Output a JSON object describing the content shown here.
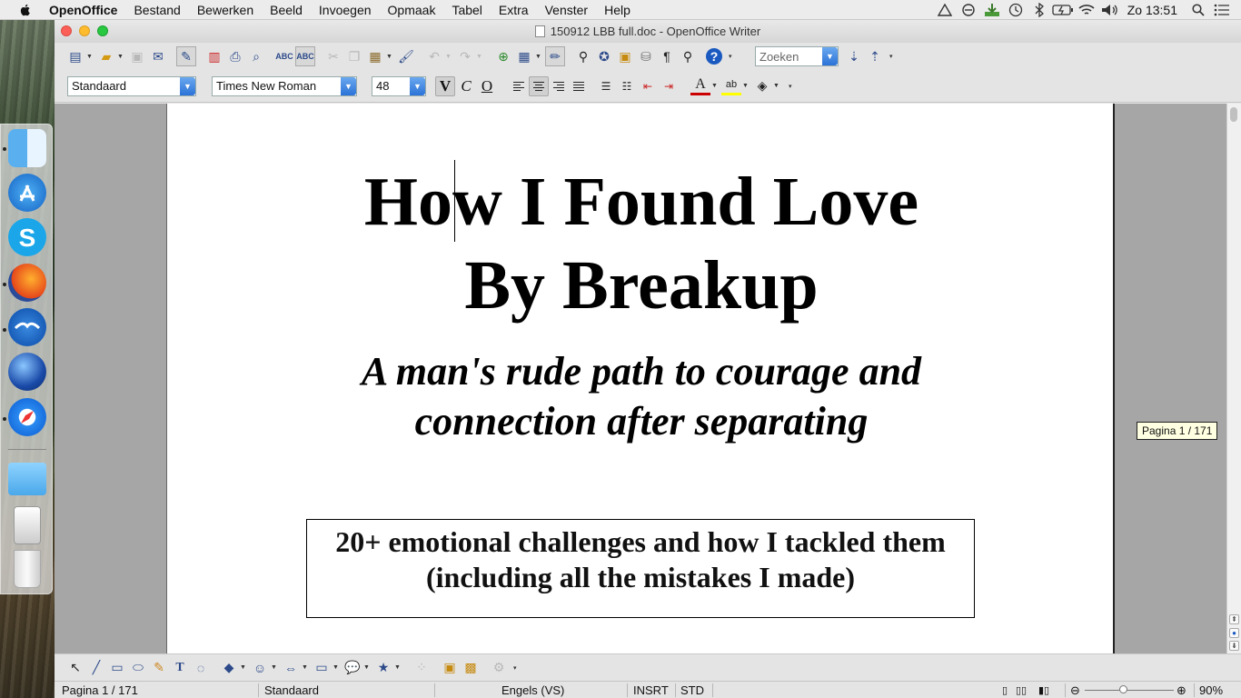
{
  "menubar": {
    "app_name": "OpenOffice",
    "items": [
      "Bestand",
      "Bewerken",
      "Beeld",
      "Invoegen",
      "Opmaak",
      "Tabel",
      "Extra",
      "Venster",
      "Help"
    ],
    "clock": "Zo 13:51"
  },
  "window": {
    "title": "150912 LBB full.doc - OpenOffice Writer"
  },
  "toolbar": {
    "search_placeholder": "Zoeken",
    "paragraph_style": "Standaard",
    "font_name": "Times New Roman",
    "font_size": "48",
    "bold_label": "V",
    "italic_label": "C",
    "underline_label": "O"
  },
  "document": {
    "title_line1": "How I Found Love",
    "title_line2": "By Breakup",
    "subtitle_line1": "A man's rude path to courage and",
    "subtitle_line2": "connection after separating",
    "box_line1": "20+ emotional challenges and how I tackled them",
    "box_line2": "(including all the mistakes I made)"
  },
  "page_tooltip": "Pagina 1 / 171",
  "statusbar": {
    "page": "Pagina 1 / 171",
    "style": "Standaard",
    "language": "Engels (VS)",
    "insert_mode": "INSRT",
    "selection_mode": "STD",
    "zoom": "90%"
  },
  "colors": {
    "accent": "#2b72d8",
    "close": "#fc5f57",
    "minimize": "#fdbc2e",
    "maximize": "#28c840"
  }
}
